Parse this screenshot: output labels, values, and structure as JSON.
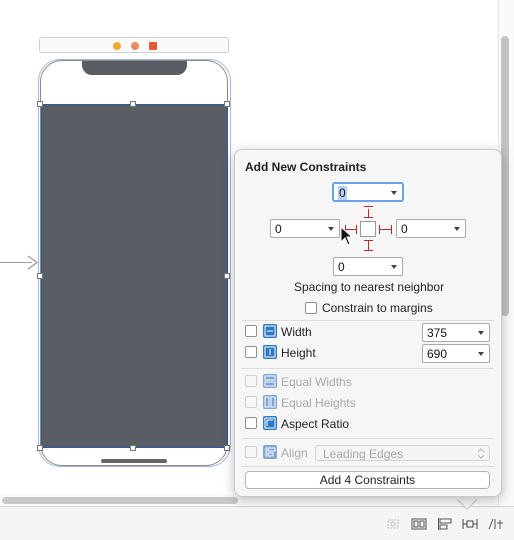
{
  "popover": {
    "title": "Add New Constraints",
    "spacing": {
      "top": "0",
      "left": "0",
      "right": "0",
      "bottom": "0"
    },
    "spacing_caption": "Spacing to nearest neighbor",
    "constrain_margins_label": "Constrain to margins",
    "width": {
      "label": "Width",
      "value": "375"
    },
    "height": {
      "label": "Height",
      "value": "690"
    },
    "equal_widths_label": "Equal Widths",
    "equal_heights_label": "Equal Heights",
    "aspect_ratio_label": "Aspect Ratio",
    "align": {
      "label": "Align",
      "value": "Leading Edges"
    },
    "add_button_label": "Add 4 Constraints"
  },
  "colors": {
    "strut": "#b52a2a",
    "view_fill": "#585e63",
    "selection_blue": "#2c5aa6",
    "icon_blue": "#2f78c4"
  },
  "icons": {
    "scene_dock": [
      "first-responder-icon",
      "view-controller-icon",
      "exit-icon"
    ],
    "toolbar": [
      "update-frames-icon",
      "embed-in-stack-icon",
      "align-icon",
      "add-constraints-icon",
      "resolve-issues-icon"
    ]
  }
}
